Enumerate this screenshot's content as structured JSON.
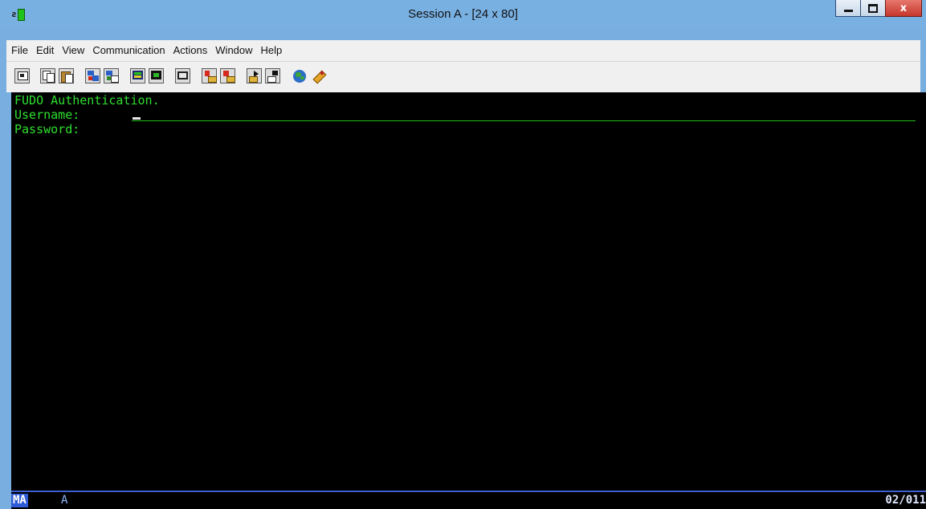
{
  "window": {
    "title": "Session A - [24 x 80]",
    "app_icon": "terminal-session-icon",
    "app_icon_text": "ƨ"
  },
  "window_controls": {
    "minimize": "minimize-icon",
    "maximize": "maximize-icon",
    "close": "x"
  },
  "menu": {
    "items": [
      "File",
      "Edit",
      "View",
      "Communication",
      "Actions",
      "Window",
      "Help"
    ]
  },
  "toolbar": {
    "buttons": [
      "print-screen-icon",
      "copy-icon",
      "paste-icon",
      "send-file-icon",
      "receive-file-icon",
      "display-setup-icon",
      "keyboard-setup-icon",
      "session-properties-icon",
      "macro-record-icon",
      "macro-stop-icon",
      "macro-play-icon",
      "macro-edit-icon",
      "web-globe-icon",
      "help-icon"
    ]
  },
  "terminal": {
    "line1": "FUDO Authentication.",
    "username_label": "Username:",
    "username_value": "",
    "password_label": "Password:",
    "text_color": "#2fe02f",
    "background": "#000000"
  },
  "status": {
    "mode": "MA",
    "session": "A",
    "cursor_position": "02/011"
  },
  "colors": {
    "title_bar": "#79b0e2",
    "close_button": "#c6372c",
    "status_accent": "#2f5bd8"
  }
}
